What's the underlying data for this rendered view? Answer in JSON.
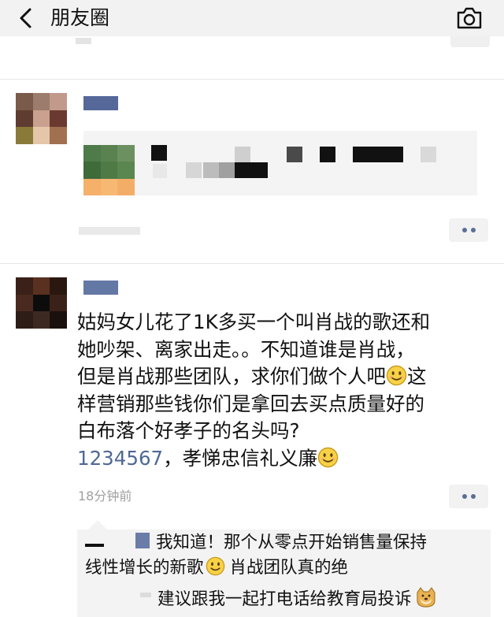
{
  "header": {
    "title": "朋友圈",
    "back_icon": "chevron-left-icon",
    "camera_icon": "camera-icon",
    "background": "#f2f2f2"
  },
  "feed": {
    "post2": {
      "text_lines": [
        "姑妈女儿花了1K多买一个叫肖战的歌还和",
        "她吵架、离家出走。。不知道谁是肖战，",
        "但是肖战那些团队，求你们做个人吧",
        "这",
        "样营销那些钱你们是拿回去买点质量好的",
        "白布落个好孝子的名头吗?",
        "1234567",
        "，孝悌忠信礼义廉"
      ],
      "time": "18分钟前",
      "link_color": "#4f6895"
    },
    "comments": [
      {
        "text": "我知道！那个从零点开始销售量保持"
      },
      {
        "text_a": "线性增长的新歌",
        "text_b": "肖战团队真的绝"
      },
      {
        "text": "建议跟我一起打电话给教育局投诉"
      }
    ],
    "more_button_dot_color": "#5a6f96"
  }
}
